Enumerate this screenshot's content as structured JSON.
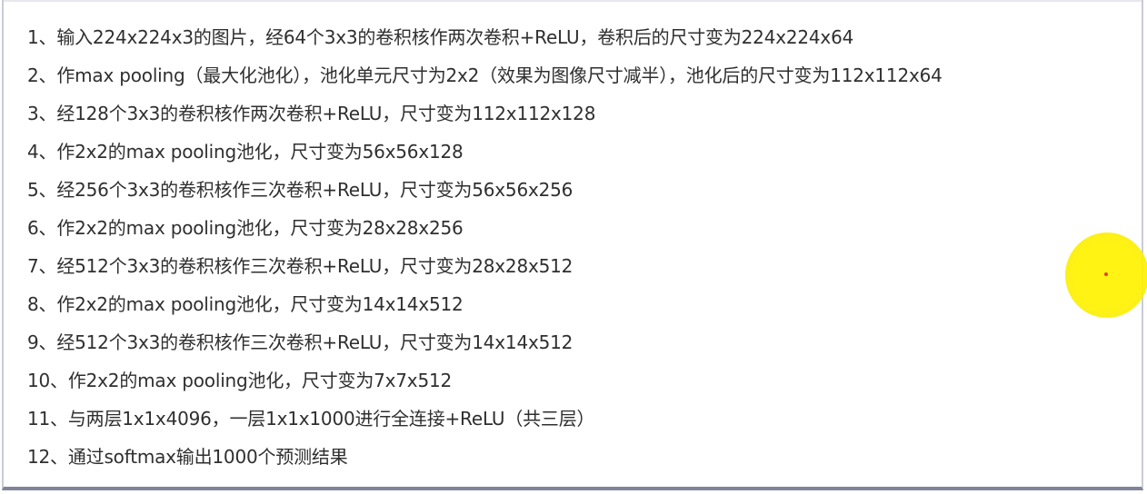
{
  "steps": [
    "1、输入224x224x3的图片，经64个3x3的卷积核作两次卷积+ReLU，卷积后的尺寸变为224x224x64",
    "2、作max pooling（最大化池化），池化单元尺寸为2x2（效果为图像尺寸减半），池化后的尺寸变为112x112x64",
    "3、经128个3x3的卷积核作两次卷积+ReLU，尺寸变为112x112x128",
    "4、作2x2的max pooling池化，尺寸变为56x56x128",
    "5、经256个3x3的卷积核作三次卷积+ReLU，尺寸变为56x56x256",
    "6、作2x2的max pooling池化，尺寸变为28x28x256",
    "7、经512个3x3的卷积核作三次卷积+ReLU，尺寸变为28x28x512",
    "8、作2x2的max pooling池化，尺寸变为14x14x512",
    "9、经512个3x3的卷积核作三次卷积+ReLU，尺寸变为14x14x512",
    "10、作2x2的max pooling池化，尺寸变为7x7x512",
    "11、与两层1x1x4096，一层1x1x1000进行全连接+ReLU（共三层）",
    "12、通过softmax输出1000个预测结果"
  ],
  "colors": {
    "text": "#2f2f2f",
    "cursor_highlight": "#fff200",
    "cursor_dot": "#e0301e",
    "frame_border": "#7f8498"
  }
}
